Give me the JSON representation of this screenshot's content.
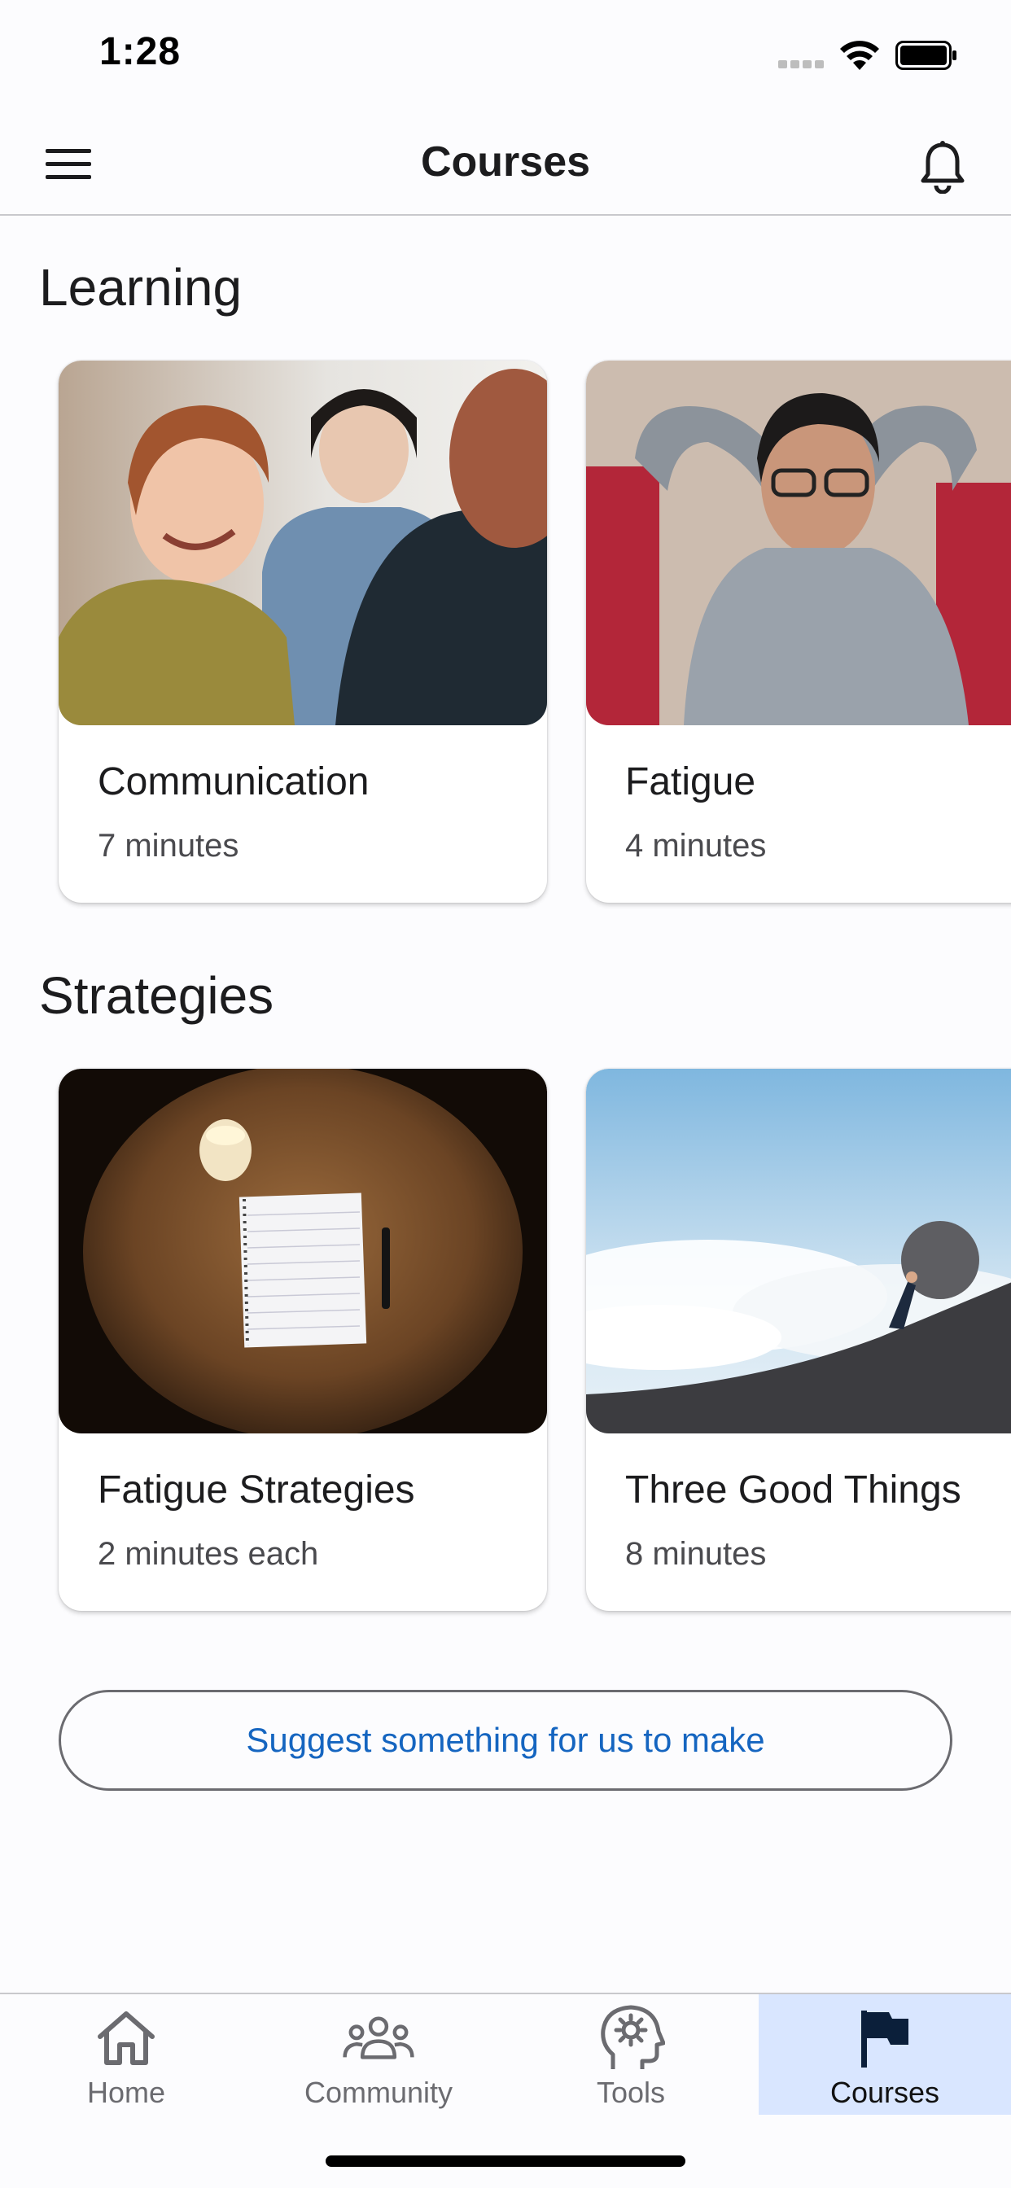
{
  "status_bar": {
    "time": "1:28"
  },
  "app_bar": {
    "title": "Courses"
  },
  "sections": [
    {
      "title": "Learning",
      "cards": [
        {
          "title": "Communication",
          "meta": "7 minutes",
          "image": "group-conversation-photo"
        },
        {
          "title": "Fatigue",
          "meta": "4 minutes",
          "image": "tired-woman-photo"
        }
      ]
    },
    {
      "title": "Strategies",
      "cards": [
        {
          "title": "Fatigue Strategies",
          "meta": "2 minutes each",
          "image": "notebook-candle-photo"
        },
        {
          "title": "Three Good Things",
          "meta": "8 minutes",
          "image": "man-pushing-boulder-photo"
        }
      ]
    }
  ],
  "suggest_button": {
    "label": "Suggest something for us to make"
  },
  "tabs": [
    {
      "label": "Home",
      "icon": "home-icon",
      "active": false
    },
    {
      "label": "Community",
      "icon": "community-icon",
      "active": false
    },
    {
      "label": "Tools",
      "icon": "tools-icon",
      "active": false
    },
    {
      "label": "Courses",
      "icon": "flag-icon",
      "active": true
    }
  ],
  "colors": {
    "accent_link": "#1565c0",
    "active_tab_bg": "#d9e6ff",
    "background": "#fcfcfe"
  }
}
